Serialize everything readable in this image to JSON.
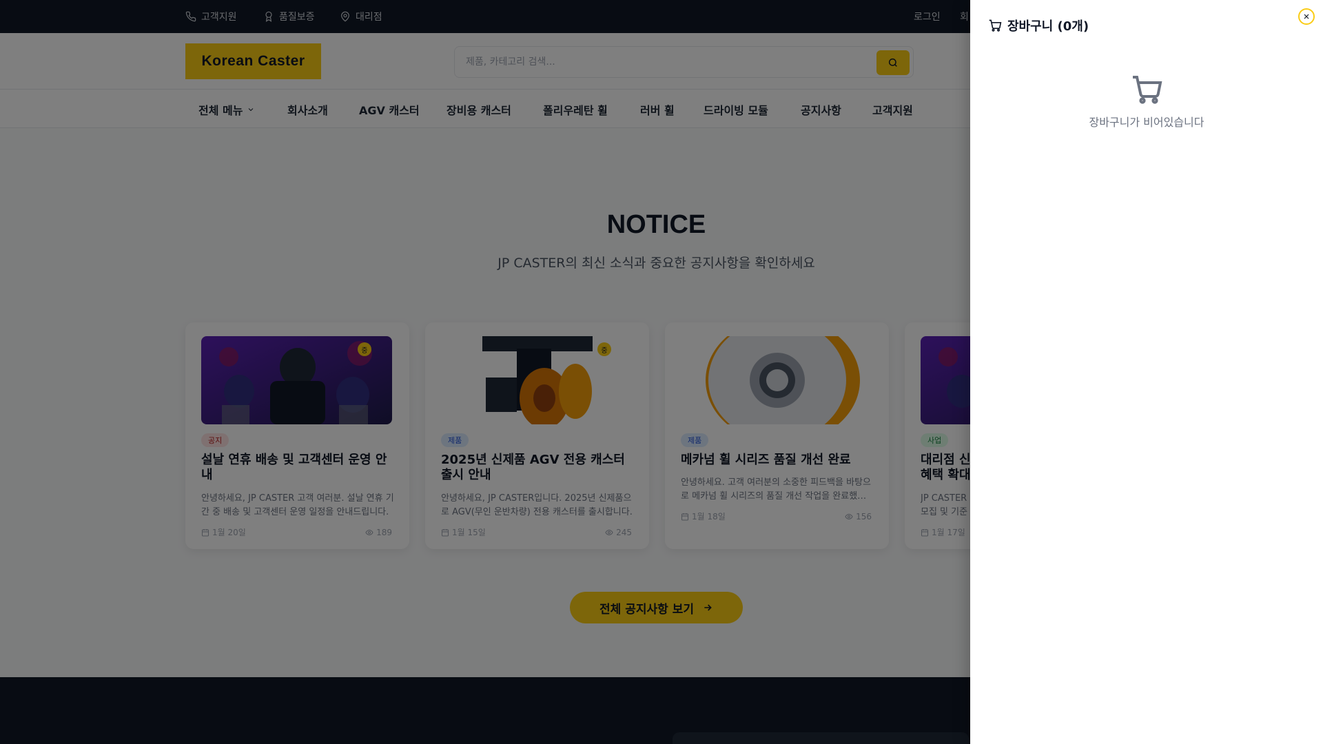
{
  "topbar": {
    "support": "고객지원",
    "quality": "품질보증",
    "dealer": "대리점",
    "login": "로그인",
    "signup": "회"
  },
  "header": {
    "logo": "Korean Caster",
    "search_placeholder": "제품, 카테고리 검색..."
  },
  "nav": {
    "items": [
      "전체 메뉴",
      "회사소개",
      "AGV 캐스터",
      "장비용 캐스터",
      "폴리우레탄 휠",
      "러버 휠",
      "드라이빙 모듈",
      "공지사항",
      "고객지원"
    ]
  },
  "notice": {
    "title": "NOTICE",
    "subtitle": "JP CASTER의 최신 소식과 중요한 공지사항을 확인하세요",
    "cards": [
      {
        "badge": "공지",
        "title": "설날 연휴 배송 및 고객센터 운영 안내",
        "body": "안녕하세요, JP CASTER 고객 여러분. 설날 연휴 기간 중 배송 및 고객센터 운영 일정을 안내드립니다.",
        "date": "1월 20일",
        "views": "189",
        "pin": "중"
      },
      {
        "badge": "제품",
        "title": "2025년 신제품 AGV 전용 캐스터 출시 안내",
        "body": "안녕하세요, JP CASTER입니다. 2025년 신제품으로 AGV(무인 운반차량) 전용 캐스터를 출시합니다.",
        "date": "1월 15일",
        "views": "245",
        "pin": "중"
      },
      {
        "badge": "제품",
        "title": "메카넘 휠 시리즈 품질 개선 완료",
        "body": "안녕하세요. 고객 여러분의 소중한 피드백을 바탕으로 메카넘 휠 시리즈의 품질 개선 작업을 완료했습니다.",
        "date": "1월 18일",
        "views": "156"
      },
      {
        "badge": "사업",
        "title": "대리점 신",
        "title2": "혜택 확대",
        "body": "JP CASTER",
        "body2": "모집 및 기준",
        "date": "1월 17일"
      }
    ],
    "all_button": "전체 공지사항 보기"
  },
  "cart": {
    "title": "장바구니 (0개)",
    "empty_text": "장바구니가 비어있습니다"
  },
  "colors": {
    "accent": "#facc15",
    "topbar": "#111827"
  }
}
